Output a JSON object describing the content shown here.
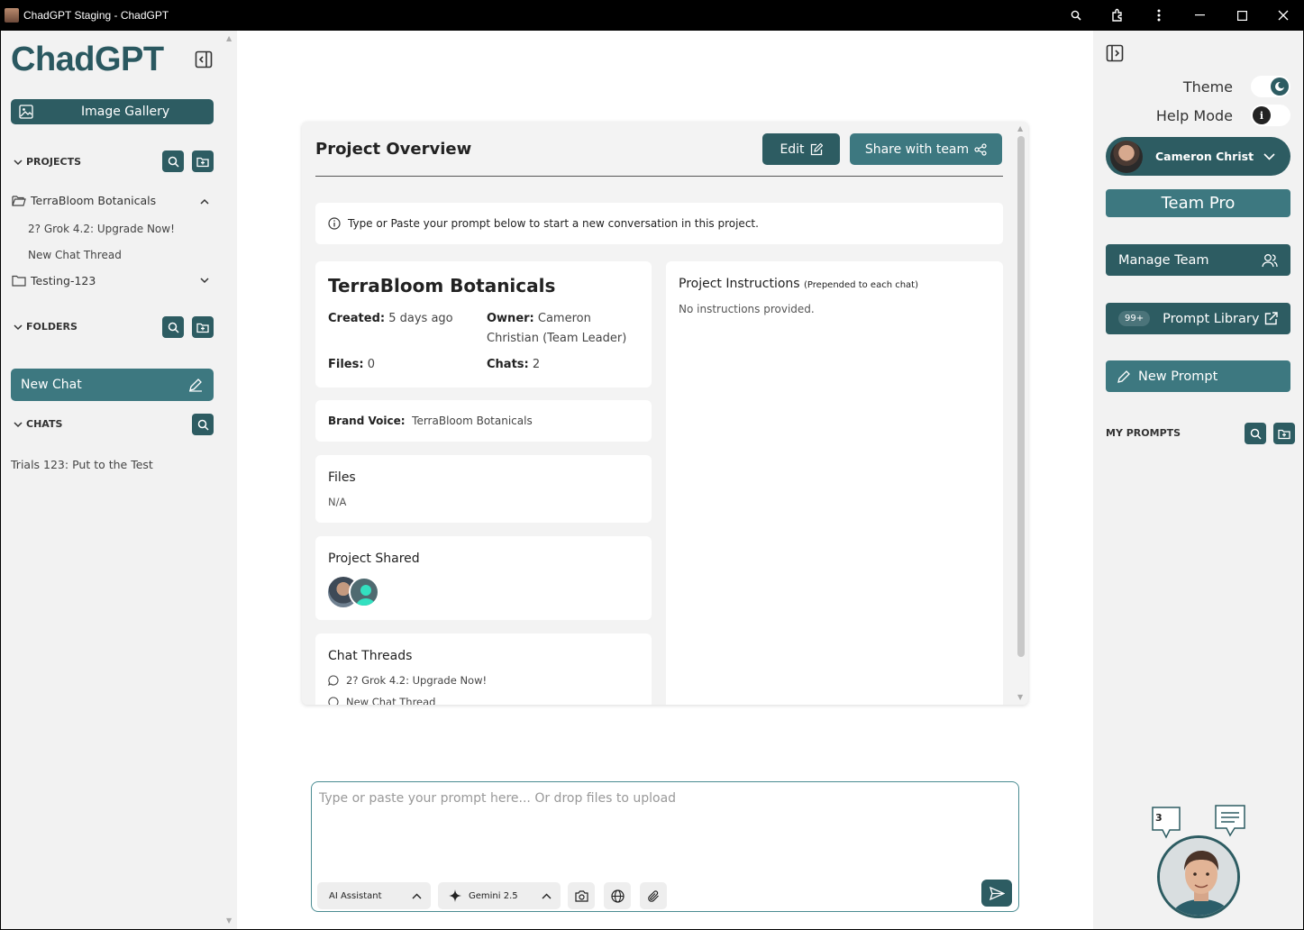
{
  "window": {
    "title": "ChadGPT Staging - ChadGPT"
  },
  "left_sidebar": {
    "logo": "ChadGPT",
    "image_gallery": "Image Gallery",
    "projects_label": "PROJECTS",
    "projects": [
      {
        "name": "TerraBloom Botanicals",
        "expanded": true,
        "children": [
          "2? Grok 4.2: Upgrade Now!",
          "New Chat Thread"
        ]
      },
      {
        "name": "Testing-123",
        "expanded": false,
        "children": []
      }
    ],
    "folders_label": "FOLDERS",
    "new_chat": "New Chat",
    "chats_label": "CHATS",
    "chats": [
      "Trials 123: Put to the Test"
    ]
  },
  "overview": {
    "title": "Project Overview",
    "edit_label": "Edit",
    "share_label": "Share with team",
    "info_text": "Type or Paste your prompt below to start a new conversation in this project.",
    "project_name": "TerraBloom Botanicals",
    "created_label": "Created:",
    "created_value": "5 days ago",
    "owner_label": "Owner:",
    "owner_value": "Cameron Christian (Team Leader)",
    "files_label": "Files:",
    "files_value": "0",
    "chats_label": "Chats:",
    "chats_value": "2",
    "brand_voice_label": "Brand Voice:",
    "brand_voice_value": "TerraBloom Botanicals",
    "files_title": "Files",
    "files_none": "N/A",
    "shared_title": "Project Shared",
    "threads_title": "Chat Threads",
    "threads": [
      "2? Grok 4.2: Upgrade Now!",
      "New Chat Thread"
    ],
    "instructions_title": "Project Instructions",
    "instructions_note": "(Prepended to each chat)",
    "instructions_text": "No instructions provided."
  },
  "prompt": {
    "placeholder": "Type or paste your prompt here... Or drop files to upload",
    "assistant": "AI Assistant",
    "model": "Gemini 2.5"
  },
  "right_sidebar": {
    "theme_label": "Theme",
    "help_label": "Help Mode",
    "user_name": "Cameron Christi...",
    "plan": "Team Pro",
    "manage_team": "Manage Team",
    "library_badge": "99+",
    "prompt_library": "Prompt Library",
    "new_prompt": "New Prompt",
    "my_prompts_label": "MY PROMPTS",
    "notification_count": "3"
  },
  "colors": {
    "teal_dark": "#2d5c62",
    "teal": "#3d7880",
    "panel": "#f2f2f2"
  }
}
